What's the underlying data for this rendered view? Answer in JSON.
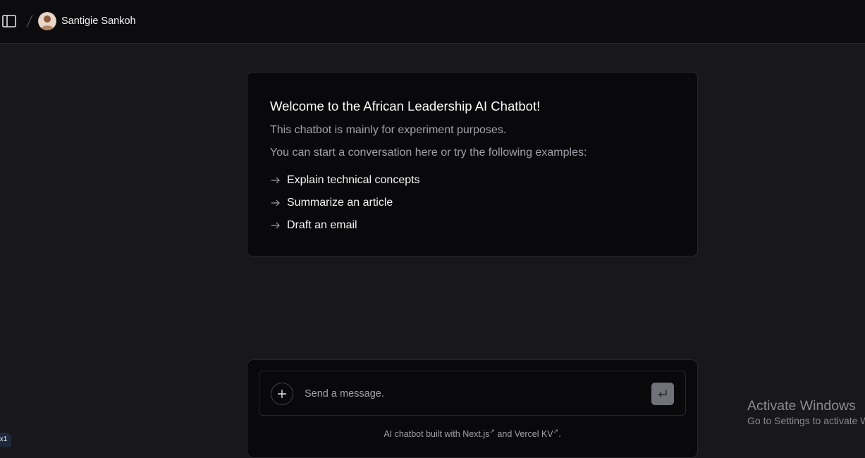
{
  "header": {
    "sidebar_toggle_icon": "sidebar-toggle-icon",
    "separator_icon": "slash-icon",
    "user": {
      "name": "Santigie Sankoh",
      "avatar_icon": "user-avatar"
    }
  },
  "welcome": {
    "title": "Welcome to the African Leadership AI Chatbot!",
    "line1": "This chatbot is mainly for experiment purposes.",
    "line2": "You can start a conversation here or try the following examples:",
    "examples": [
      {
        "label": "Explain technical concepts",
        "icon": "arrow-right-icon"
      },
      {
        "label": "Summarize an article",
        "icon": "arrow-right-icon"
      },
      {
        "label": "Draft an email",
        "icon": "arrow-right-icon"
      }
    ]
  },
  "composer": {
    "placeholder": "Send a message.",
    "value": "",
    "add_icon": "plus-icon",
    "send_icon": "enter-icon"
  },
  "footer": {
    "prefix": "AI chatbot built with ",
    "link1": "Next.js",
    "middle": " and ",
    "link2": "Vercel KV",
    "suffix": ".",
    "external_icon": "external-link-icon"
  },
  "watermark": {
    "title": "Activate Windows",
    "subtitle": "Go to Settings to activate Windows."
  },
  "corner_badge": {
    "text": "x1"
  },
  "colors": {
    "background": "#18181b",
    "header_background": "#0c0c0e",
    "card_background": "#09090b",
    "border": "#27272a",
    "muted_text": "#a1a1aa",
    "send_button": "#71717a"
  }
}
